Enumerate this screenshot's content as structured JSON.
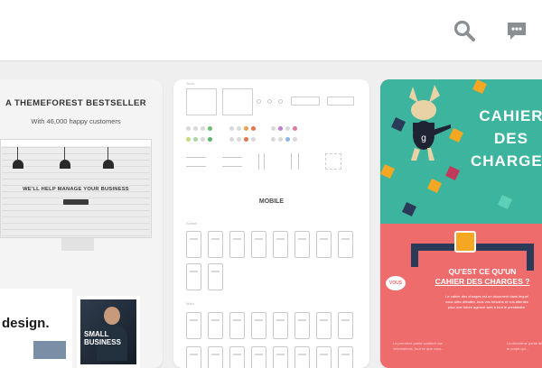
{
  "header": {
    "icons": [
      "search-icon",
      "chat-icon"
    ]
  },
  "cards": [
    {
      "kind": "themeforest-template",
      "title": "A THEMEFOREST BESTSELLER",
      "subtitle": "With 46,000 happy customers",
      "screen_headline": "WE'LL HELP MANAGE YOUR BUSINESS",
      "tile_design_text": "design.",
      "tile_business_text": "SMALL BUSINESS"
    },
    {
      "kind": "wireframe-kit",
      "tag": "Tools",
      "section_label": "MOBILE",
      "subsection_1": "Splash",
      "subsection_2": "Main"
    },
    {
      "kind": "cahier-des-charges",
      "title": "CAHIER DES CHARGES",
      "question_line1": "QU'EST CE QU'UN",
      "question_line2": "CAHIER DES CHARGES ?",
      "body": "Le cahier des charges est un document dans lequel vous allez détailler, tous vos besoins et vos attentes pour une future agence web à tout le prestataire.",
      "badge": "VOUS",
      "bottom_left_note": "La première partie contient vos informations, tout ce que vous...",
      "bottom_right_note": "La deuxième partie décrit le projet qui..."
    }
  ],
  "colors": {
    "header_bg": "#ffffff",
    "page_bg": "#efefef",
    "icon": "#8a8f94",
    "teal": "#3db59e",
    "coral": "#ee6c6c",
    "navy": "#2c3a5a",
    "accent_yellow": "#f5a623"
  }
}
